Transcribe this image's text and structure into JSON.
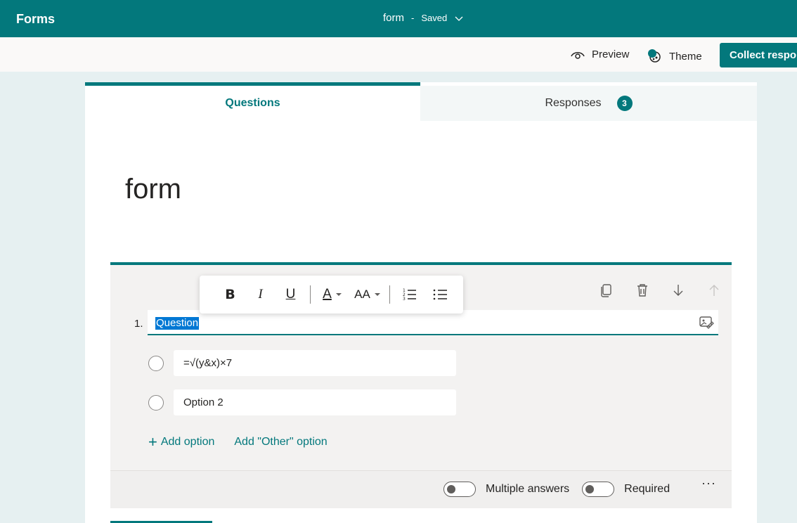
{
  "app": {
    "name": "Forms"
  },
  "header": {
    "form_name": "form",
    "separator": "-",
    "status": "Saved"
  },
  "commands": {
    "preview": "Preview",
    "theme": "Theme",
    "collect": "Collect responses"
  },
  "tabs": [
    {
      "label": "Questions",
      "active": true
    },
    {
      "label": "Responses",
      "badge": "3"
    }
  ],
  "form": {
    "title": "form"
  },
  "question": {
    "number": "1.",
    "text": "Question",
    "options": [
      "=√(y&x)×7",
      "Option 2"
    ],
    "add_option": "Add option",
    "add_other": "Add \"Other\" option",
    "multiple_answers": "Multiple answers",
    "required": "Required",
    "more": "···"
  },
  "format_toolbar": {
    "bold": "B",
    "italic": "I",
    "underline": "U",
    "font_color": "A",
    "font_size": "AA"
  },
  "colors": {
    "accent": "#03787c",
    "selection": "#0078d4"
  }
}
